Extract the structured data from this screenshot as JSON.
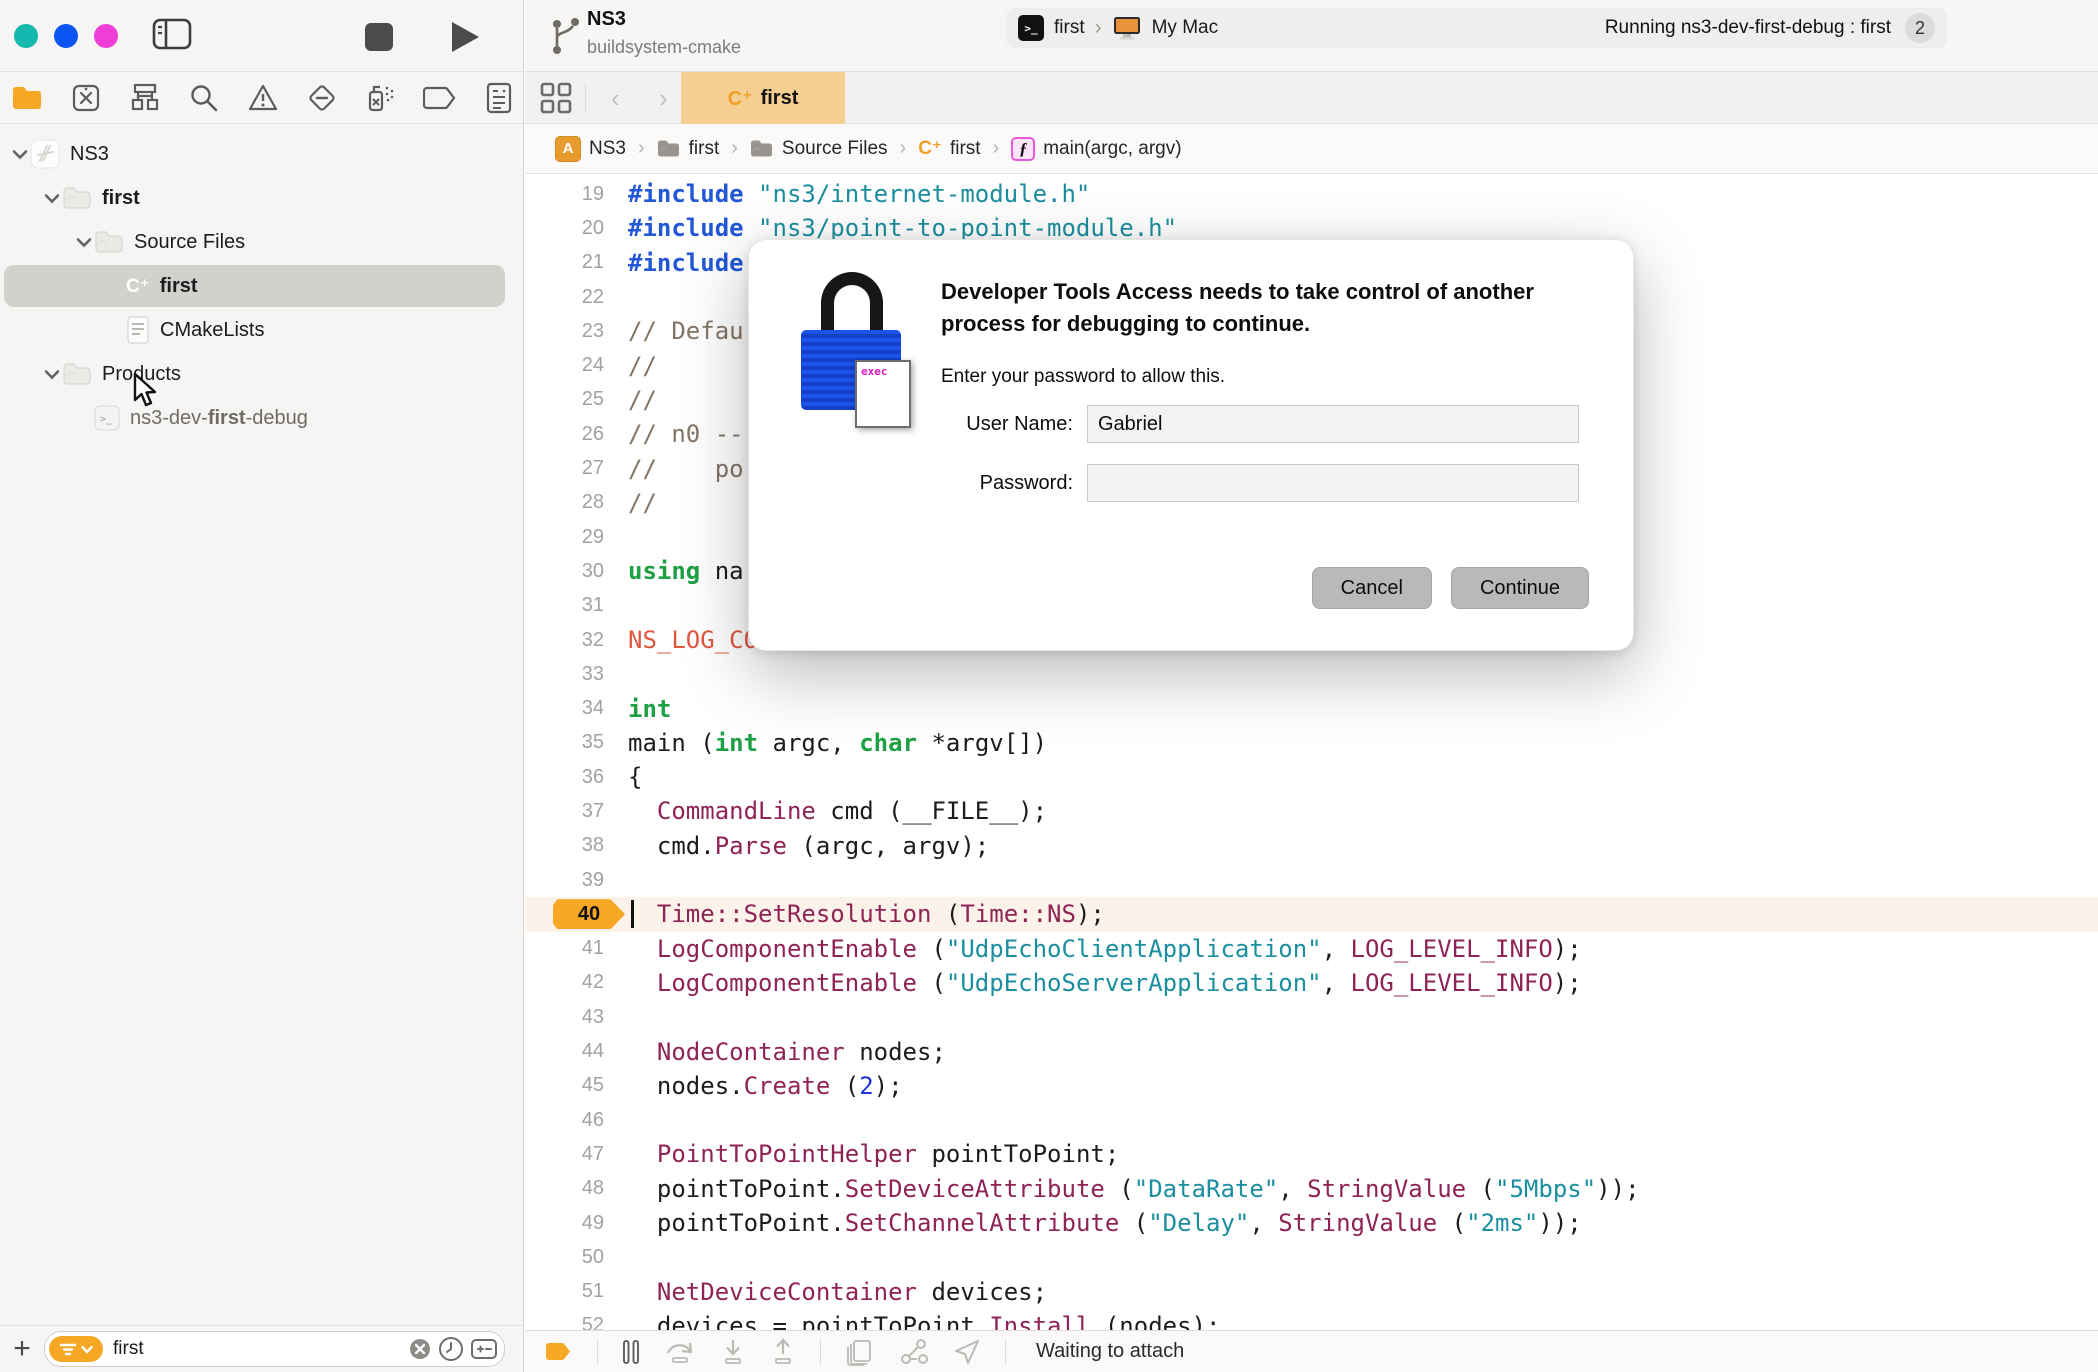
{
  "colors": {
    "accent_orange": "#f6a723",
    "tab_tan": "#f5ce92",
    "traffic_teal": "#14b8ae",
    "traffic_blue": "#0c55f3",
    "traffic_magenta": "#ee3ed6",
    "selection_gray": "#d3d1ce",
    "breakpoint_row": "#fbf2e9",
    "string_teal": "#1b8e9f",
    "keyword_green": "#1fa045",
    "directive_blue": "#2258d6",
    "type_maroon": "#8f2355"
  },
  "toolbar": {
    "project_title": "NS3",
    "project_subtitle": "buildsystem-cmake",
    "scheme": "first",
    "destination": "My Mac",
    "terminal_glyph": ">_",
    "status": "Running ns3-dev-first-debug : first",
    "status_badge": "2"
  },
  "titlebar_icons": [
    "close-button",
    "minimize-button",
    "zoom-button",
    "sidebar-toggle-icon",
    "stop-button",
    "play-button"
  ],
  "navigator": {
    "icons": [
      "project-navigator-icon",
      "source-control-icon",
      "symbols-icon",
      "find-icon",
      "issues-icon",
      "tests-icon",
      "debug-gauge-icon",
      "breakpoints-icon",
      "reports-icon"
    ],
    "active": 0
  },
  "sidebar": {
    "tree": [
      {
        "label": "NS3",
        "icon": "xcode-project-icon",
        "level": 0,
        "chevron": true,
        "bold": false
      },
      {
        "label": "first",
        "icon": "folder-icon",
        "level": 1,
        "chevron": true,
        "bold": true
      },
      {
        "label": "Source Files",
        "icon": "folder-icon",
        "level": 2,
        "chevron": true,
        "bold": false
      },
      {
        "label": "first",
        "icon": "cpp-file-icon",
        "level": 3,
        "chevron": false,
        "bold": true,
        "selected": true
      },
      {
        "label": "CMakeLists",
        "icon": "document-icon",
        "level": 3,
        "chevron": false,
        "bold": false
      },
      {
        "label": "Products",
        "icon": "folder-icon",
        "level": 1,
        "chevron": true,
        "bold": false
      },
      {
        "parts": [
          {
            "t": "ns3-dev-"
          },
          {
            "t": "first",
            "b": true
          },
          {
            "t": "-debug"
          }
        ],
        "label": "ns3-dev-first-debug",
        "icon": "executable-icon",
        "level": 2,
        "chevron": false,
        "muted": true
      }
    ],
    "filter": {
      "value": "first",
      "icons": [
        "filter-pill-icon",
        "clear-icon",
        "history-icon",
        "scope-icon"
      ],
      "add_button": "+"
    }
  },
  "tabbar": {
    "tab_icon": "C⁺",
    "tab_label": "first",
    "back": "‹",
    "forward": "›"
  },
  "jumpbar": {
    "crumbs": [
      {
        "icon": "app-target-icon",
        "label": "NS3"
      },
      {
        "icon": "folder-small-icon",
        "label": "first"
      },
      {
        "icon": "folder-small-icon",
        "label": "Source Files"
      },
      {
        "icon": "cpp-badge",
        "label": "first"
      },
      {
        "icon": "function-icon",
        "label": "main(argc, argv)"
      }
    ]
  },
  "dialog": {
    "title": "Developer Tools Access needs to take control of another process for debugging to continue.",
    "message": "Enter your password to allow this.",
    "user_label": "User Name:",
    "user_value": "Gabriel",
    "password_label": "Password:",
    "password_value": "",
    "cancel_label": "Cancel",
    "continue_label": "Continue",
    "lock_card_text": "exec"
  },
  "editor": {
    "breakpoint_line": 40,
    "lines": [
      {
        "n": 19,
        "t": [
          [
            "d",
            "#include "
          ],
          [
            "s",
            "\"ns3/internet-module.h\""
          ]
        ]
      },
      {
        "n": 20,
        "t": [
          [
            "d",
            "#include "
          ],
          [
            "s",
            "\"ns3/point-to-point-module.h\""
          ]
        ]
      },
      {
        "n": 21,
        "t": [
          [
            "d",
            "#include"
          ]
        ]
      },
      {
        "n": 22,
        "t": []
      },
      {
        "n": 23,
        "t": [
          [
            "c",
            "// Defau"
          ]
        ]
      },
      {
        "n": 24,
        "t": [
          [
            "c",
            "//"
          ]
        ]
      },
      {
        "n": 25,
        "t": [
          [
            "c",
            "//"
          ]
        ]
      },
      {
        "n": 26,
        "t": [
          [
            "c",
            "// n0 --"
          ]
        ]
      },
      {
        "n": 27,
        "t": [
          [
            "c",
            "//    po"
          ]
        ]
      },
      {
        "n": 28,
        "t": [
          [
            "c",
            "//"
          ]
        ]
      },
      {
        "n": 29,
        "t": []
      },
      {
        "n": 30,
        "t": [
          [
            "k",
            "using "
          ],
          [
            "p",
            "na"
          ]
        ]
      },
      {
        "n": 31,
        "t": []
      },
      {
        "n": 32,
        "t": [
          [
            "o",
            "NS_LOG_CO"
          ]
        ]
      },
      {
        "n": 33,
        "t": []
      },
      {
        "n": 34,
        "t": [
          [
            "k",
            "int"
          ]
        ]
      },
      {
        "n": 35,
        "t": [
          [
            "p",
            "main ("
          ],
          [
            "k",
            "int"
          ],
          [
            "p",
            " argc, "
          ],
          [
            "k",
            "char"
          ],
          [
            "p",
            " *argv[])"
          ]
        ]
      },
      {
        "n": 36,
        "t": [
          [
            "p",
            "{"
          ]
        ]
      },
      {
        "n": 37,
        "t": [
          [
            "p",
            "  "
          ],
          [
            "t",
            "CommandLine"
          ],
          [
            "p",
            " cmd (__FILE__);"
          ]
        ]
      },
      {
        "n": 38,
        "t": [
          [
            "p",
            "  cmd."
          ],
          [
            "t",
            "Parse"
          ],
          [
            "p",
            " (argc, argv);"
          ]
        ]
      },
      {
        "n": 39,
        "t": []
      },
      {
        "n": 40,
        "t": [
          [
            "p",
            "  "
          ],
          [
            "t",
            "Time::SetResolution"
          ],
          [
            "p",
            " ("
          ],
          [
            "t",
            "Time::NS"
          ],
          [
            "p",
            ");"
          ]
        ],
        "hl": true,
        "bp": true,
        "caret": true
      },
      {
        "n": 41,
        "t": [
          [
            "p",
            "  "
          ],
          [
            "t",
            "LogComponentEnable"
          ],
          [
            "p",
            " ("
          ],
          [
            "s",
            "\"UdpEchoClientApplication\""
          ],
          [
            "p",
            ", "
          ],
          [
            "t",
            "LOG_LEVEL_INFO"
          ],
          [
            "p",
            ");"
          ]
        ]
      },
      {
        "n": 42,
        "t": [
          [
            "p",
            "  "
          ],
          [
            "t",
            "LogComponentEnable"
          ],
          [
            "p",
            " ("
          ],
          [
            "s",
            "\"UdpEchoServerApplication\""
          ],
          [
            "p",
            ", "
          ],
          [
            "t",
            "LOG_LEVEL_INFO"
          ],
          [
            "p",
            ");"
          ]
        ]
      },
      {
        "n": 43,
        "t": []
      },
      {
        "n": 44,
        "t": [
          [
            "p",
            "  "
          ],
          [
            "t",
            "NodeContainer"
          ],
          [
            "p",
            " nodes;"
          ]
        ]
      },
      {
        "n": 45,
        "t": [
          [
            "p",
            "  nodes."
          ],
          [
            "t",
            "Create"
          ],
          [
            "p",
            " ("
          ],
          [
            "n2",
            "2"
          ],
          [
            "p",
            ");"
          ]
        ]
      },
      {
        "n": 46,
        "t": []
      },
      {
        "n": 47,
        "t": [
          [
            "p",
            "  "
          ],
          [
            "t",
            "PointToPointHelper"
          ],
          [
            "p",
            " pointToPoint;"
          ]
        ]
      },
      {
        "n": 48,
        "t": [
          [
            "p",
            "  pointToPoint."
          ],
          [
            "t",
            "SetDeviceAttribute"
          ],
          [
            "p",
            " ("
          ],
          [
            "s",
            "\"DataRate\""
          ],
          [
            "p",
            ", "
          ],
          [
            "t",
            "StringValue"
          ],
          [
            "p",
            " ("
          ],
          [
            "s",
            "\"5Mbps\""
          ],
          [
            "p",
            "));"
          ]
        ]
      },
      {
        "n": 49,
        "t": [
          [
            "p",
            "  pointToPoint."
          ],
          [
            "t",
            "SetChannelAttribute"
          ],
          [
            "p",
            " ("
          ],
          [
            "s",
            "\"Delay\""
          ],
          [
            "p",
            ", "
          ],
          [
            "t",
            "StringValue"
          ],
          [
            "p",
            " ("
          ],
          [
            "s",
            "\"2ms\""
          ],
          [
            "p",
            "));"
          ]
        ]
      },
      {
        "n": 50,
        "t": []
      },
      {
        "n": 51,
        "t": [
          [
            "p",
            "  "
          ],
          [
            "t",
            "NetDeviceContainer"
          ],
          [
            "p",
            " devices;"
          ]
        ]
      },
      {
        "n": 52,
        "t": [
          [
            "p",
            "  devices = pointToPoint."
          ],
          [
            "t",
            "Install"
          ],
          [
            "p",
            " (nodes);"
          ]
        ]
      }
    ]
  },
  "debugbar": {
    "icons": [
      "breakpoints-toggle-icon",
      "pause-icon",
      "step-over-icon",
      "step-into-icon",
      "step-out-icon",
      "view-hierarchy-icon",
      "memory-graph-icon",
      "simulate-location-icon"
    ],
    "status": "Waiting to attach"
  }
}
